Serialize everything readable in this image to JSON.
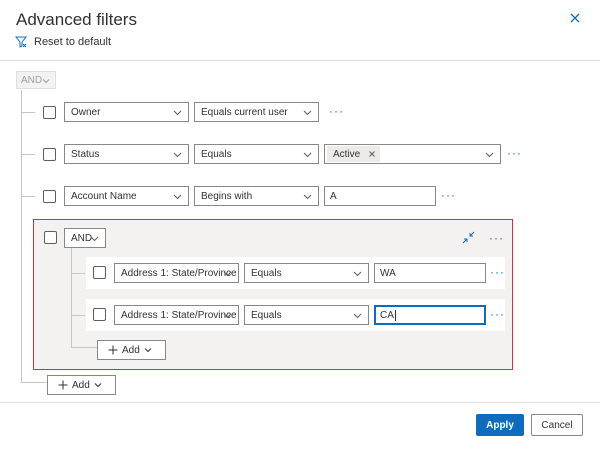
{
  "dialog": {
    "title": "Advanced filters",
    "reset_label": "Reset to default"
  },
  "root_group": {
    "operator": "AND",
    "add_label": "Add"
  },
  "rows": [
    {
      "field": "Owner",
      "operator": "Equals current user",
      "value": ""
    },
    {
      "field": "Status",
      "operator": "Equals",
      "value_tag": "Active"
    },
    {
      "field": "Account Name",
      "operator": "Begins with",
      "value": "A"
    }
  ],
  "nested_group": {
    "operator": "AND",
    "add_label": "Add",
    "rows": [
      {
        "field": "Address 1: State/Province",
        "operator": "Equals",
        "value": "WA"
      },
      {
        "field": "Address 1: State/Province",
        "operator": "Equals",
        "value": "CA"
      }
    ]
  },
  "footer": {
    "apply_label": "Apply",
    "cancel_label": "Cancel"
  },
  "icons": {
    "close": "close-icon",
    "reset": "filter-reset-icon",
    "chevron": "chevron-down-icon",
    "more": "more-icon",
    "collapse": "collapse-icon",
    "add": "plus-icon",
    "remove": "remove-tag-icon"
  },
  "colors": {
    "accent": "#0f6cbd",
    "selected_border": "#d13438",
    "group_bg": "#f3f2f1"
  }
}
